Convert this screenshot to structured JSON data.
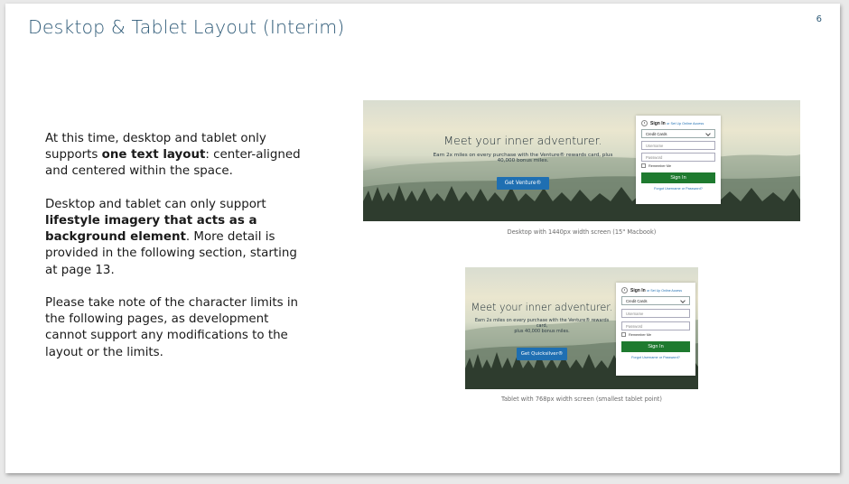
{
  "slide": {
    "title": "Desktop & Tablet Layout (Interim)",
    "page_number": "6"
  },
  "body": {
    "p1_a": "At this time, desktop and tablet only supports ",
    "p1_bold": "one text layout",
    "p1_b": ": center-aligned and centered within the space.",
    "p2_a": "Desktop and tablet can only support ",
    "p2_bold": "lifestyle imagery that acts as a background element",
    "p2_b": ". More detail is provided in the following section, starting at page 13.",
    "p3": "Please take note of the character limits in the following pages, as development cannot support any modifications to the layout or the limits."
  },
  "desktop_mock": {
    "headline": "Meet your inner adventurer.",
    "subtext_1": "Earn 2x miles on every purchase with the Venture® rewards card, plus",
    "subtext_2": "40,000 bonus miles.",
    "cta_label": "Get Venture®",
    "caption": "Desktop with 1440px width screen (15\" Macbook)"
  },
  "tablet_mock": {
    "headline": "Meet your inner adventurer.",
    "subtext_1": "Earn 2x miles on every purchase with the Venture® rewards card,",
    "subtext_2": "plus 40,000 bonus miles.",
    "cta_label": "Get Quicksilver®",
    "caption": "Tablet with 768px width screen (smallest tablet point)"
  },
  "signin": {
    "heading": "Sign In",
    "setup_link": "or Set Up Online Access",
    "select_value": "Credit Cards",
    "username_placeholder": "Username",
    "password_placeholder": "Password",
    "remember_label": "Remember Me",
    "button_label": "Sign In",
    "forgot_link": "Forgot Username or Password?"
  },
  "colors": {
    "title": "#2f5b78",
    "cta_blue": "#1f6fb2",
    "signin_green": "#1e7a2f"
  },
  "icons": [
    "user-icon",
    "chevron-down-icon",
    "checkbox-icon"
  ]
}
